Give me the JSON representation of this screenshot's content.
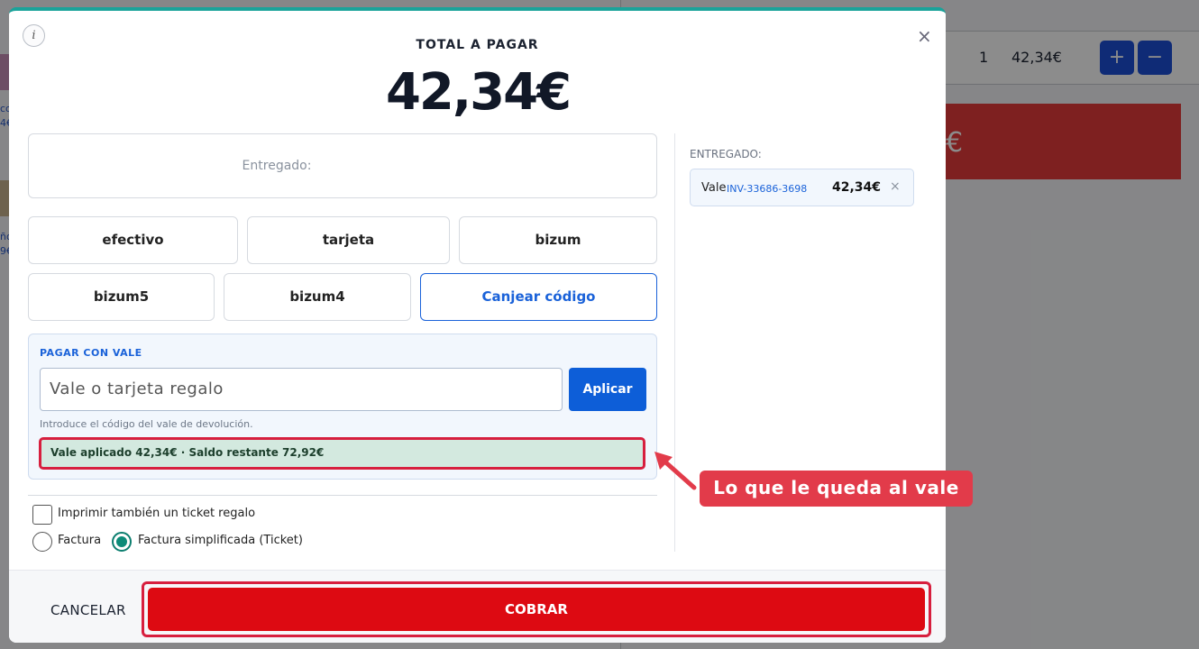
{
  "background": {
    "qty": "1",
    "price": "42,34€",
    "plus_label": "+",
    "minus_label": "−",
    "red_banner_text": "€",
    "left_snippets": [
      "co",
      "4€",
      "ño",
      "9€"
    ]
  },
  "modal": {
    "info_label": "i",
    "close_label": "×",
    "total_label": "TOTAL A PAGAR",
    "total_amount": "42,34€",
    "tendered_label": "Entregado:",
    "payment_methods_row1": [
      "efectivo",
      "tarjeta",
      "bizum"
    ],
    "payment_methods_row2": [
      "bizum5",
      "bizum4",
      "Canjear código"
    ],
    "active_method": "Canjear código",
    "voucher": {
      "title": "PAGAR CON VALE",
      "placeholder": "Vale o tarjeta regalo",
      "apply_label": "Aplicar",
      "help": "Introduce el código del vale de devolución.",
      "status": "Vale aplicado 42,34€ · Saldo restante 72,92€"
    },
    "gift_ticket_label": "Imprimir también un ticket regalo",
    "invoice_options": [
      "Factura",
      "Factura simplificada (Ticket)"
    ],
    "selected_invoice": "Factura simplificada (Ticket)",
    "given": {
      "title": "ENTREGADO:",
      "name": "Vale",
      "code": "INV-33686-3698",
      "amount": "42,34€",
      "remove_label": "×"
    },
    "cancel_label": "CANCELAR",
    "charge_label": "COBRAR"
  },
  "annotation": {
    "text": "Lo que le queda al vale",
    "color": "#e23b4a"
  },
  "colors": {
    "accent": "#1a62d9",
    "charge": "#dd0a12",
    "success_bg": "#d3e9df",
    "radio_on": "#0c8b78",
    "top_bar": "#1aa39a"
  }
}
